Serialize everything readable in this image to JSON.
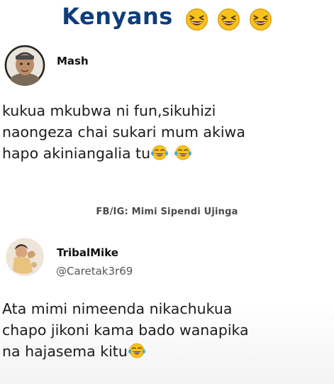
{
  "header": {
    "title": "Kenyans",
    "emoji": "grinning-squinting-face-icon"
  },
  "posts": [
    {
      "author": "Mash",
      "handle": "",
      "avatar": "profile-photo-man",
      "lines": [
        "kukua mkubwa ni fun,sikuhizi",
        "naongeza chai sukari mum akiwa",
        "hapo akiniangalia tu"
      ],
      "emoji": "face-with-tears-of-joy-icon",
      "credit": "FB/IG: Mimi Sipendi Ujinga"
    },
    {
      "author": "TribalMike",
      "handle": "@Caretak3r69",
      "avatar": "profile-photo-child",
      "lines": [
        "Ata mimi nimeenda nikachukua",
        "chapo  jikoni kama bado wanapika",
        "na hajasema kitu"
      ],
      "emoji": "face-with-tears-of-joy-icon"
    }
  ],
  "colors": {
    "title": "#0f3d7a",
    "emoji_face": "#f6c21c",
    "tears": "#3fa7e8",
    "text": "#1c1c1c"
  }
}
